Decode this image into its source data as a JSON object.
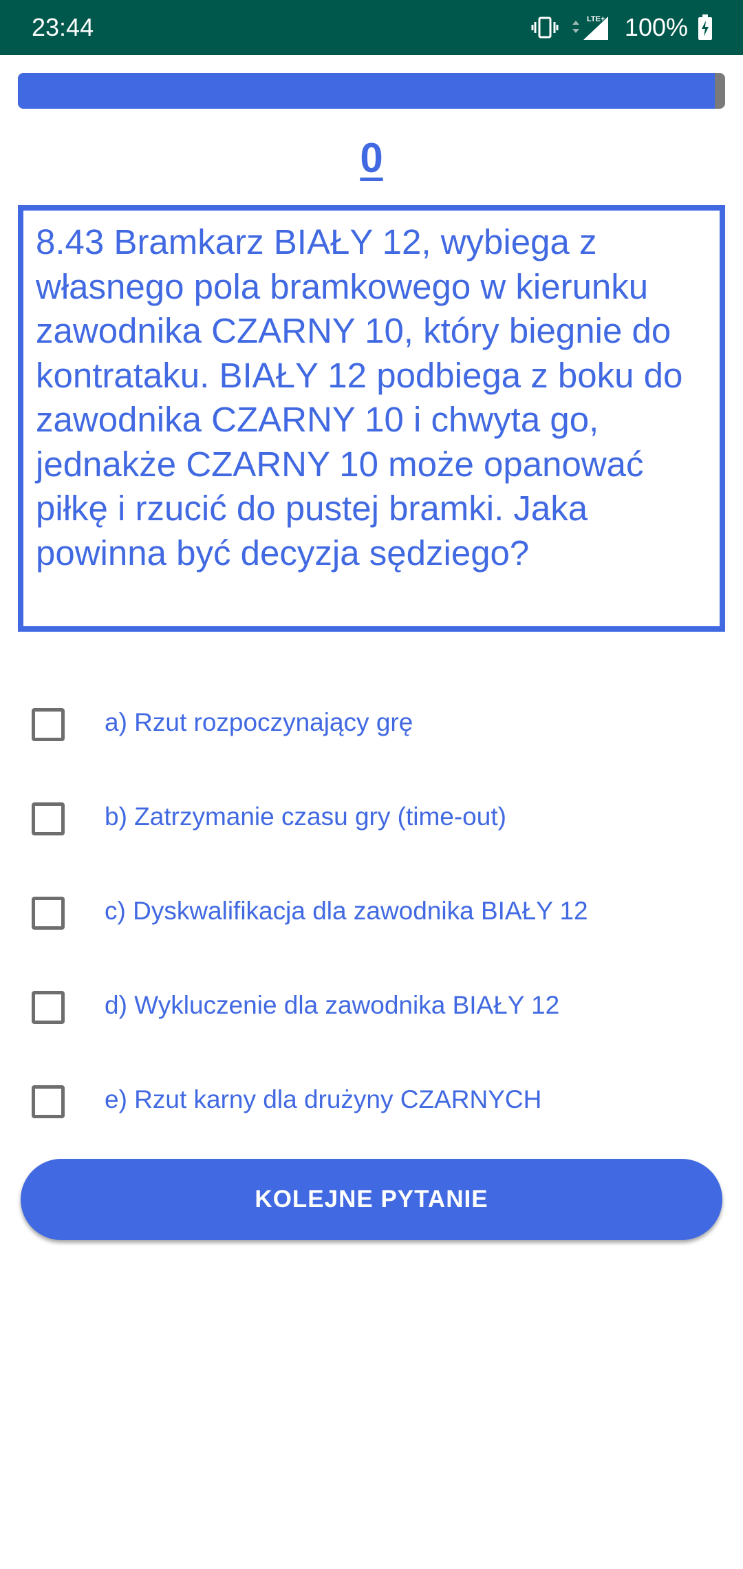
{
  "status_bar": {
    "time": "23:44",
    "battery_text": "100%",
    "icons": [
      "vibrate-icon",
      "lte-signal-icon",
      "battery-charging-icon"
    ],
    "network_label": "LTE+",
    "background_color": "#00574b"
  },
  "quiz": {
    "progress_fraction": 0.985,
    "score": "0",
    "question": "8.43 Bramkarz BIAŁY 12, wybiega z własnego pola bramkowego w kierunku zawodnika CZARNY 10, który biegnie do kontrataku. BIAŁY 12 podbiega z boku do zawodnika CZARNY 10 i chwyta go, jednakże CZARNY 10 może opanować piłkę i rzucić do pustej bramki. Jaka powinna być decyzja sędziego?",
    "answers": [
      {
        "label": "a) Rzut rozpoczynający grę",
        "checked": false
      },
      {
        "label": "b) Zatrzymanie czasu gry (time-out)",
        "checked": false
      },
      {
        "label": "c) Dyskwalifikacja dla zawodnika BIAŁY 12",
        "checked": false
      },
      {
        "label": "d) Wykluczenie dla zawodnika BIAŁY 12",
        "checked": false
      },
      {
        "label": "e) Rzut karny dla drużyny CZARNYCH",
        "checked": false
      }
    ],
    "next_button_label": "KOLEJNE PYTANIE",
    "accent_color": "#4169e1"
  }
}
